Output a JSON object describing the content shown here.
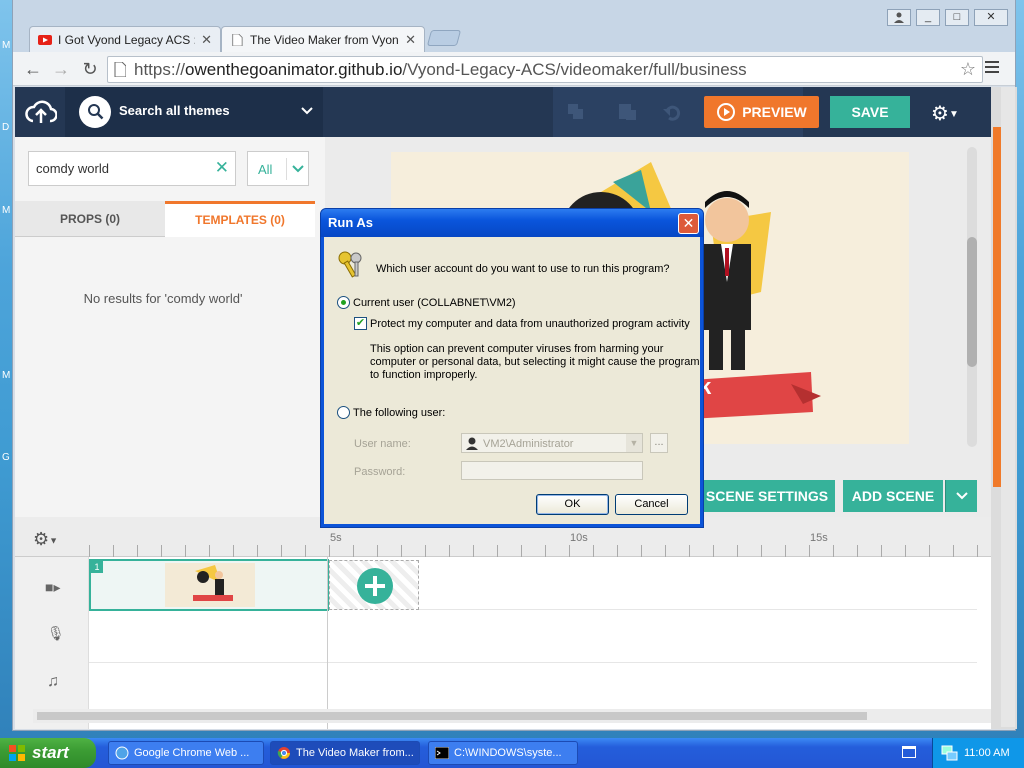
{
  "browser": {
    "tabs": [
      {
        "title": "I Got Vyond Legacy ACS :D.",
        "close": "✕"
      },
      {
        "title": "The Video Maker from Vyond",
        "close": "✕"
      }
    ],
    "url_prefix": "https://",
    "url_host": "owenthegoanimator.github.io",
    "url_path": "/Vyond-Legacy-ACS/videomaker/full/business",
    "window_buttons": [
      "_",
      "□",
      "✕"
    ]
  },
  "app": {
    "search_label": "Search all themes",
    "search_value": "comdy world",
    "filter": "All",
    "tabs": {
      "props": "PROPS (0)",
      "templates": "TEMPLATES (0)"
    },
    "no_results": "No results for 'comdy world'",
    "preview": "PREVIEW",
    "save": "SAVE",
    "scene_settings": "SCENE SETTINGS",
    "add_scene": "ADD SCENE",
    "ticks": [
      "5s",
      "10s",
      "15s"
    ],
    "scene_number": "1",
    "banner_fragment": "k"
  },
  "dialog": {
    "title": "Run As",
    "question": "Which user account do you want to use to run this program?",
    "current_user": "Current user (COLLABNET\\VM2)",
    "protect": "Protect my computer and data from unauthorized program activity",
    "protect_note": "This option can prevent computer viruses from harming your computer or personal data, but selecting it might cause the program to function improperly.",
    "following_user": "The following user:",
    "username_label": "User name:",
    "username_value": "VM2\\Administrator",
    "password_label": "Password:",
    "browse": "...",
    "ok": "OK",
    "cancel": "Cancel"
  },
  "taskbar": {
    "start": "start",
    "items": [
      "Google Chrome Web ...",
      "The Video Maker from...",
      "C:\\WINDOWS\\syste..."
    ],
    "clock": "11:00 AM"
  },
  "colors": {
    "accent_orange": "#f0772c",
    "accent_teal": "#36b29a",
    "topbar": "#243753"
  }
}
